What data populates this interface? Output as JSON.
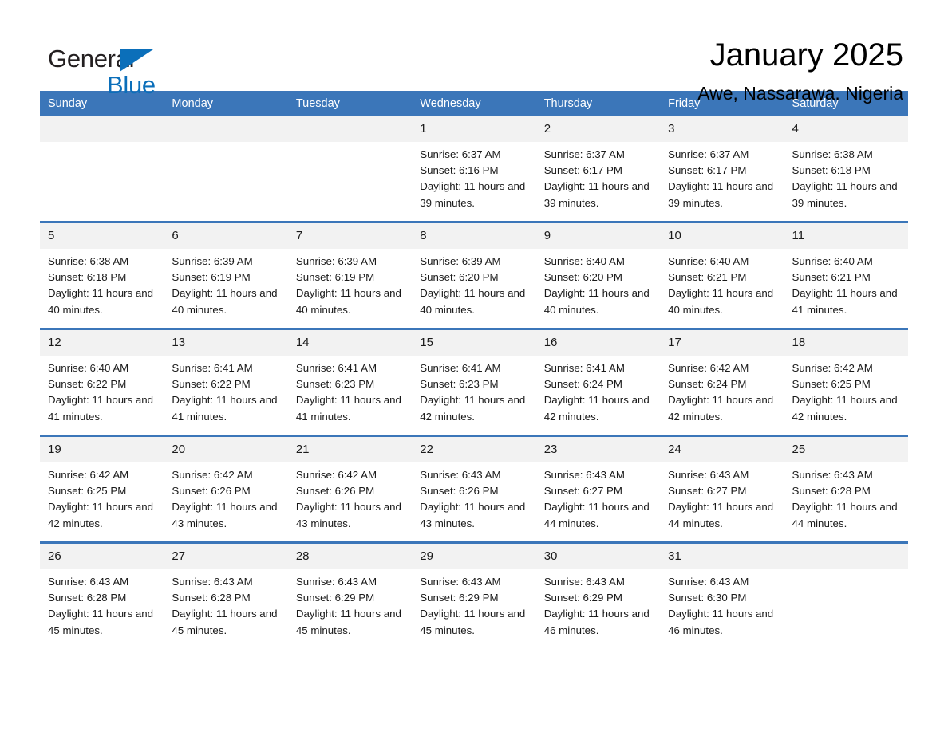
{
  "brand": {
    "name_top": "General",
    "name_bottom": "Blue",
    "accent_color": "#0b6fba"
  },
  "header": {
    "title": "January 2025",
    "location": "Awe, Nassarawa, Nigeria"
  },
  "theme": {
    "header_blue": "#3b76b9",
    "daynum_band": "#f2f2f2",
    "text": "#1a1a1a"
  },
  "weekday_headers": [
    "Sunday",
    "Monday",
    "Tuesday",
    "Wednesday",
    "Thursday",
    "Friday",
    "Saturday"
  ],
  "weeks": [
    [
      {
        "day": "",
        "sunrise": "",
        "sunset": "",
        "daylight": "",
        "empty": true
      },
      {
        "day": "",
        "sunrise": "",
        "sunset": "",
        "daylight": "",
        "empty": true
      },
      {
        "day": "",
        "sunrise": "",
        "sunset": "",
        "daylight": "",
        "empty": true
      },
      {
        "day": "1",
        "sunrise": "Sunrise: 6:37 AM",
        "sunset": "Sunset: 6:16 PM",
        "daylight": "Daylight: 11 hours and 39 minutes.",
        "empty": false
      },
      {
        "day": "2",
        "sunrise": "Sunrise: 6:37 AM",
        "sunset": "Sunset: 6:17 PM",
        "daylight": "Daylight: 11 hours and 39 minutes.",
        "empty": false
      },
      {
        "day": "3",
        "sunrise": "Sunrise: 6:37 AM",
        "sunset": "Sunset: 6:17 PM",
        "daylight": "Daylight: 11 hours and 39 minutes.",
        "empty": false
      },
      {
        "day": "4",
        "sunrise": "Sunrise: 6:38 AM",
        "sunset": "Sunset: 6:18 PM",
        "daylight": "Daylight: 11 hours and 39 minutes.",
        "empty": false
      }
    ],
    [
      {
        "day": "5",
        "sunrise": "Sunrise: 6:38 AM",
        "sunset": "Sunset: 6:18 PM",
        "daylight": "Daylight: 11 hours and 40 minutes.",
        "empty": false
      },
      {
        "day": "6",
        "sunrise": "Sunrise: 6:39 AM",
        "sunset": "Sunset: 6:19 PM",
        "daylight": "Daylight: 11 hours and 40 minutes.",
        "empty": false
      },
      {
        "day": "7",
        "sunrise": "Sunrise: 6:39 AM",
        "sunset": "Sunset: 6:19 PM",
        "daylight": "Daylight: 11 hours and 40 minutes.",
        "empty": false
      },
      {
        "day": "8",
        "sunrise": "Sunrise: 6:39 AM",
        "sunset": "Sunset: 6:20 PM",
        "daylight": "Daylight: 11 hours and 40 minutes.",
        "empty": false
      },
      {
        "day": "9",
        "sunrise": "Sunrise: 6:40 AM",
        "sunset": "Sunset: 6:20 PM",
        "daylight": "Daylight: 11 hours and 40 minutes.",
        "empty": false
      },
      {
        "day": "10",
        "sunrise": "Sunrise: 6:40 AM",
        "sunset": "Sunset: 6:21 PM",
        "daylight": "Daylight: 11 hours and 40 minutes.",
        "empty": false
      },
      {
        "day": "11",
        "sunrise": "Sunrise: 6:40 AM",
        "sunset": "Sunset: 6:21 PM",
        "daylight": "Daylight: 11 hours and 41 minutes.",
        "empty": false
      }
    ],
    [
      {
        "day": "12",
        "sunrise": "Sunrise: 6:40 AM",
        "sunset": "Sunset: 6:22 PM",
        "daylight": "Daylight: 11 hours and 41 minutes.",
        "empty": false
      },
      {
        "day": "13",
        "sunrise": "Sunrise: 6:41 AM",
        "sunset": "Sunset: 6:22 PM",
        "daylight": "Daylight: 11 hours and 41 minutes.",
        "empty": false
      },
      {
        "day": "14",
        "sunrise": "Sunrise: 6:41 AM",
        "sunset": "Sunset: 6:23 PM",
        "daylight": "Daylight: 11 hours and 41 minutes.",
        "empty": false
      },
      {
        "day": "15",
        "sunrise": "Sunrise: 6:41 AM",
        "sunset": "Sunset: 6:23 PM",
        "daylight": "Daylight: 11 hours and 42 minutes.",
        "empty": false
      },
      {
        "day": "16",
        "sunrise": "Sunrise: 6:41 AM",
        "sunset": "Sunset: 6:24 PM",
        "daylight": "Daylight: 11 hours and 42 minutes.",
        "empty": false
      },
      {
        "day": "17",
        "sunrise": "Sunrise: 6:42 AM",
        "sunset": "Sunset: 6:24 PM",
        "daylight": "Daylight: 11 hours and 42 minutes.",
        "empty": false
      },
      {
        "day": "18",
        "sunrise": "Sunrise: 6:42 AM",
        "sunset": "Sunset: 6:25 PM",
        "daylight": "Daylight: 11 hours and 42 minutes.",
        "empty": false
      }
    ],
    [
      {
        "day": "19",
        "sunrise": "Sunrise: 6:42 AM",
        "sunset": "Sunset: 6:25 PM",
        "daylight": "Daylight: 11 hours and 42 minutes.",
        "empty": false
      },
      {
        "day": "20",
        "sunrise": "Sunrise: 6:42 AM",
        "sunset": "Sunset: 6:26 PM",
        "daylight": "Daylight: 11 hours and 43 minutes.",
        "empty": false
      },
      {
        "day": "21",
        "sunrise": "Sunrise: 6:42 AM",
        "sunset": "Sunset: 6:26 PM",
        "daylight": "Daylight: 11 hours and 43 minutes.",
        "empty": false
      },
      {
        "day": "22",
        "sunrise": "Sunrise: 6:43 AM",
        "sunset": "Sunset: 6:26 PM",
        "daylight": "Daylight: 11 hours and 43 minutes.",
        "empty": false
      },
      {
        "day": "23",
        "sunrise": "Sunrise: 6:43 AM",
        "sunset": "Sunset: 6:27 PM",
        "daylight": "Daylight: 11 hours and 44 minutes.",
        "empty": false
      },
      {
        "day": "24",
        "sunrise": "Sunrise: 6:43 AM",
        "sunset": "Sunset: 6:27 PM",
        "daylight": "Daylight: 11 hours and 44 minutes.",
        "empty": false
      },
      {
        "day": "25",
        "sunrise": "Sunrise: 6:43 AM",
        "sunset": "Sunset: 6:28 PM",
        "daylight": "Daylight: 11 hours and 44 minutes.",
        "empty": false
      }
    ],
    [
      {
        "day": "26",
        "sunrise": "Sunrise: 6:43 AM",
        "sunset": "Sunset: 6:28 PM",
        "daylight": "Daylight: 11 hours and 45 minutes.",
        "empty": false
      },
      {
        "day": "27",
        "sunrise": "Sunrise: 6:43 AM",
        "sunset": "Sunset: 6:28 PM",
        "daylight": "Daylight: 11 hours and 45 minutes.",
        "empty": false
      },
      {
        "day": "28",
        "sunrise": "Sunrise: 6:43 AM",
        "sunset": "Sunset: 6:29 PM",
        "daylight": "Daylight: 11 hours and 45 minutes.",
        "empty": false
      },
      {
        "day": "29",
        "sunrise": "Sunrise: 6:43 AM",
        "sunset": "Sunset: 6:29 PM",
        "daylight": "Daylight: 11 hours and 45 minutes.",
        "empty": false
      },
      {
        "day": "30",
        "sunrise": "Sunrise: 6:43 AM",
        "sunset": "Sunset: 6:29 PM",
        "daylight": "Daylight: 11 hours and 46 minutes.",
        "empty": false
      },
      {
        "day": "31",
        "sunrise": "Sunrise: 6:43 AM",
        "sunset": "Sunset: 6:30 PM",
        "daylight": "Daylight: 11 hours and 46 minutes.",
        "empty": false
      },
      {
        "day": "",
        "sunrise": "",
        "sunset": "",
        "daylight": "",
        "empty": true
      }
    ]
  ]
}
